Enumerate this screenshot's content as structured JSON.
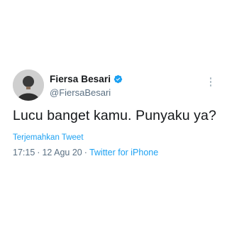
{
  "author": {
    "display_name": "Fiersa Besari",
    "handle": "@FiersaBesari",
    "verified": true,
    "avatar_icon": "profile-photo"
  },
  "tweet": {
    "text": "Lucu banget kamu. Punyaku ya?",
    "translate_label": "Terjemahkan Tweet",
    "time": "17:15",
    "date": "12 Agu 20",
    "separator": "·",
    "source": "Twitter for iPhone"
  },
  "colors": {
    "link": "#1da1f2",
    "secondary_text": "#5b7083",
    "verified_badge": "#1da1f2"
  },
  "icons": {
    "verified": "verified-badge-icon",
    "more": "more-options-icon"
  }
}
